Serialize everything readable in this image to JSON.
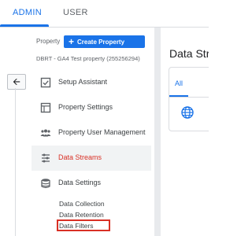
{
  "tabs": [
    {
      "label": "ADMIN",
      "active": true
    },
    {
      "label": "USER",
      "active": false
    }
  ],
  "back_button": {
    "icon": "arrow-left-icon"
  },
  "property": {
    "label": "Property",
    "create_button_label": "Create Property",
    "name": "DBRT - GA4 Test property (255256294)"
  },
  "nav": [
    {
      "label": "Setup Assistant",
      "icon": "checkbox-icon",
      "active": false
    },
    {
      "label": "Property Settings",
      "icon": "property-settings-icon",
      "active": false
    },
    {
      "label": "Property User Management",
      "icon": "users-icon",
      "active": false
    },
    {
      "label": "Data Streams",
      "icon": "data-streams-icon",
      "active": true
    },
    {
      "label": "Data Settings",
      "icon": "database-icon",
      "active": false
    }
  ],
  "sub_items": [
    {
      "label": "Data Collection"
    },
    {
      "label": "Data Retention"
    },
    {
      "label": "Data Filters",
      "highlighted": true
    }
  ],
  "right_panel": {
    "title": "Data Streams",
    "tab_label": "All",
    "stream_icon": "globe-icon"
  },
  "colors": {
    "accent": "#1a73e8",
    "active_text": "#d93025",
    "highlight_box": "#d93025"
  }
}
